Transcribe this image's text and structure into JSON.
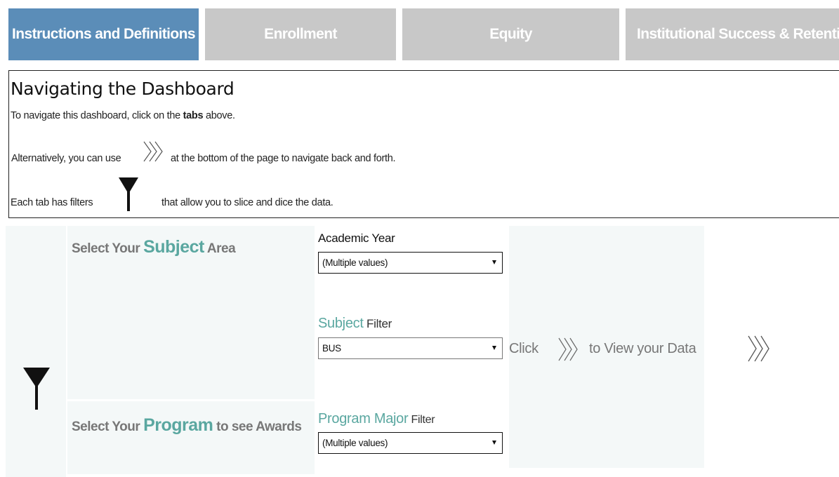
{
  "tabs": [
    {
      "label": "Instructions and Definitions",
      "active": true
    },
    {
      "label": "Enrollment",
      "active": false
    },
    {
      "label": "Equity",
      "active": false
    },
    {
      "label": "Institutional Success & Retention",
      "active": false
    }
  ],
  "instructions": {
    "title": "Navigating the Dashboard",
    "line1_pre": "To navigate this dashboard, click on the ",
    "line1_bold": "tabs",
    "line1_post": " above.",
    "line2_pre": "Alternatively, you can use",
    "line2_post": "at the bottom of the page to navigate back and forth.",
    "line3_pre": "Each tab has filters",
    "line3_post": "that allow you to slice and dice the data."
  },
  "filters": {
    "subject_heading": {
      "pre": "Select Your ",
      "accent": "Subject",
      "post": " Area"
    },
    "program_heading": {
      "pre": "Select Your ",
      "accent": "Program",
      "post": " to see Awards"
    },
    "academic_year": {
      "label": "Academic Year",
      "value": "(Multiple values)"
    },
    "subject_filter": {
      "accent": "Subject",
      "label": " Filter",
      "value": "BUS"
    },
    "program_filter": {
      "accent": "Program Major",
      "label": " Filter",
      "value": "(Multiple values)"
    },
    "click_pre": "Click",
    "click_post": "to View your Data"
  },
  "colors": {
    "tab_active": "#5b8db8",
    "tab_inactive": "#c8c8c8",
    "accent_teal": "#5aa7a0",
    "panel_bg": "#f4f8f8"
  },
  "icons": {
    "next": "triple-chevron-right-icon",
    "filter": "filter-funnel-icon"
  }
}
